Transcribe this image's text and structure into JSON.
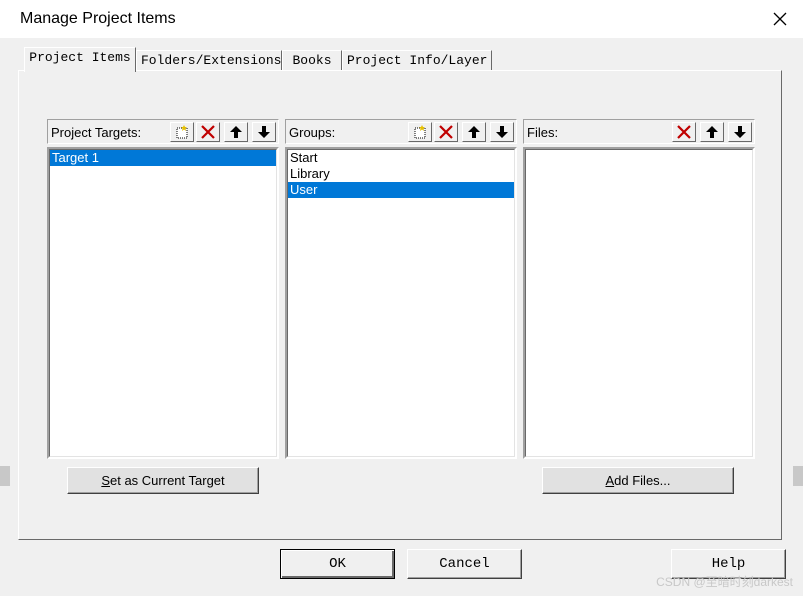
{
  "window": {
    "title": "Manage Project Items",
    "close_glyph": "✕"
  },
  "tabs": [
    {
      "label": "Project Items",
      "active": true
    },
    {
      "label": "Folders/Extensions",
      "active": false
    },
    {
      "label": "Books",
      "active": false
    },
    {
      "label": "Project Info/Layer",
      "active": false
    }
  ],
  "targets": {
    "label": "Project Targets:",
    "items": [
      {
        "text": "Target 1",
        "selected": true
      }
    ]
  },
  "groups": {
    "label": "Groups:",
    "items": [
      {
        "text": "Start",
        "selected": false
      },
      {
        "text": "Library",
        "selected": false
      },
      {
        "text": "User",
        "selected": true
      }
    ]
  },
  "files": {
    "label": "Files:",
    "items": []
  },
  "buttons": {
    "set_current_target_u": "S",
    "set_current_target_rest": "et as Current Target",
    "add_files_u": "A",
    "add_files_rest": "dd Files...",
    "ok": "OK",
    "cancel": "Cancel",
    "help": "Help"
  },
  "icons": {
    "new": "new-item-icon",
    "delete": "delete-icon",
    "up": "move-up-icon",
    "down": "move-down-icon"
  },
  "colors": {
    "selection": "#0078d7",
    "delete_red": "#c00000"
  },
  "watermark": "CSDN @至暗时刻darkest"
}
